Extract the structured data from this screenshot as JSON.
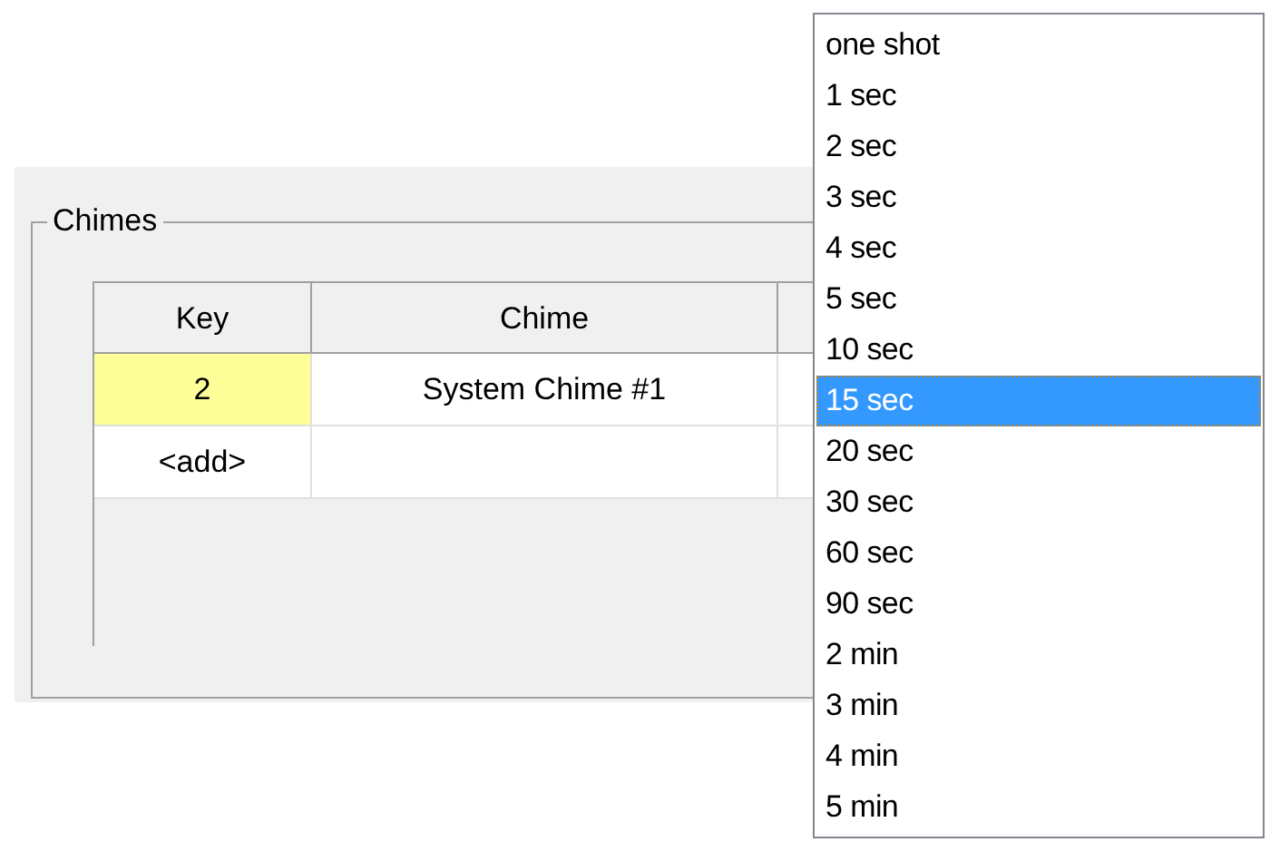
{
  "group": {
    "title": "Chimes"
  },
  "table": {
    "columns": [
      "Key",
      "Chime"
    ],
    "rows": [
      {
        "cells": [
          "2",
          "System Chime #1"
        ],
        "selected": true
      },
      {
        "cells": [
          "<add>"
        ],
        "selected": false
      }
    ]
  },
  "dropdown": {
    "items": [
      {
        "label": "one shot",
        "selected": false
      },
      {
        "label": "1 sec",
        "selected": false
      },
      {
        "label": "2 sec",
        "selected": false
      },
      {
        "label": "3 sec",
        "selected": false
      },
      {
        "label": "4 sec",
        "selected": false
      },
      {
        "label": "5 sec",
        "selected": false
      },
      {
        "label": "10 sec",
        "selected": false
      },
      {
        "label": "15 sec",
        "selected": true
      },
      {
        "label": "20 sec",
        "selected": false
      },
      {
        "label": "30 sec",
        "selected": false
      },
      {
        "label": "60 sec",
        "selected": false
      },
      {
        "label": "90 sec",
        "selected": false
      },
      {
        "label": "2 min",
        "selected": false
      },
      {
        "label": "3 min",
        "selected": false
      },
      {
        "label": "4 min",
        "selected": false
      },
      {
        "label": "5 min",
        "selected": false
      }
    ]
  }
}
